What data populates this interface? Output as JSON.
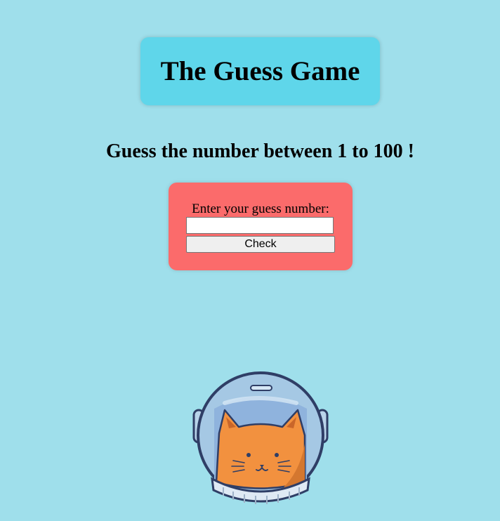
{
  "header": {
    "title": "The Guess Game"
  },
  "prompt": {
    "subtitle": "Guess the number between 1 to 100 !"
  },
  "guess_form": {
    "label": "Enter your guess number:",
    "input_value": "",
    "input_placeholder": "",
    "check_label": "Check"
  },
  "illustration": {
    "icon": "astronaut-cat-icon"
  },
  "colors": {
    "background": "#9fdfeb",
    "title_box": "#5fd6ea",
    "form_card": "#fb6b6b",
    "cat_orange": "#f2913f"
  }
}
